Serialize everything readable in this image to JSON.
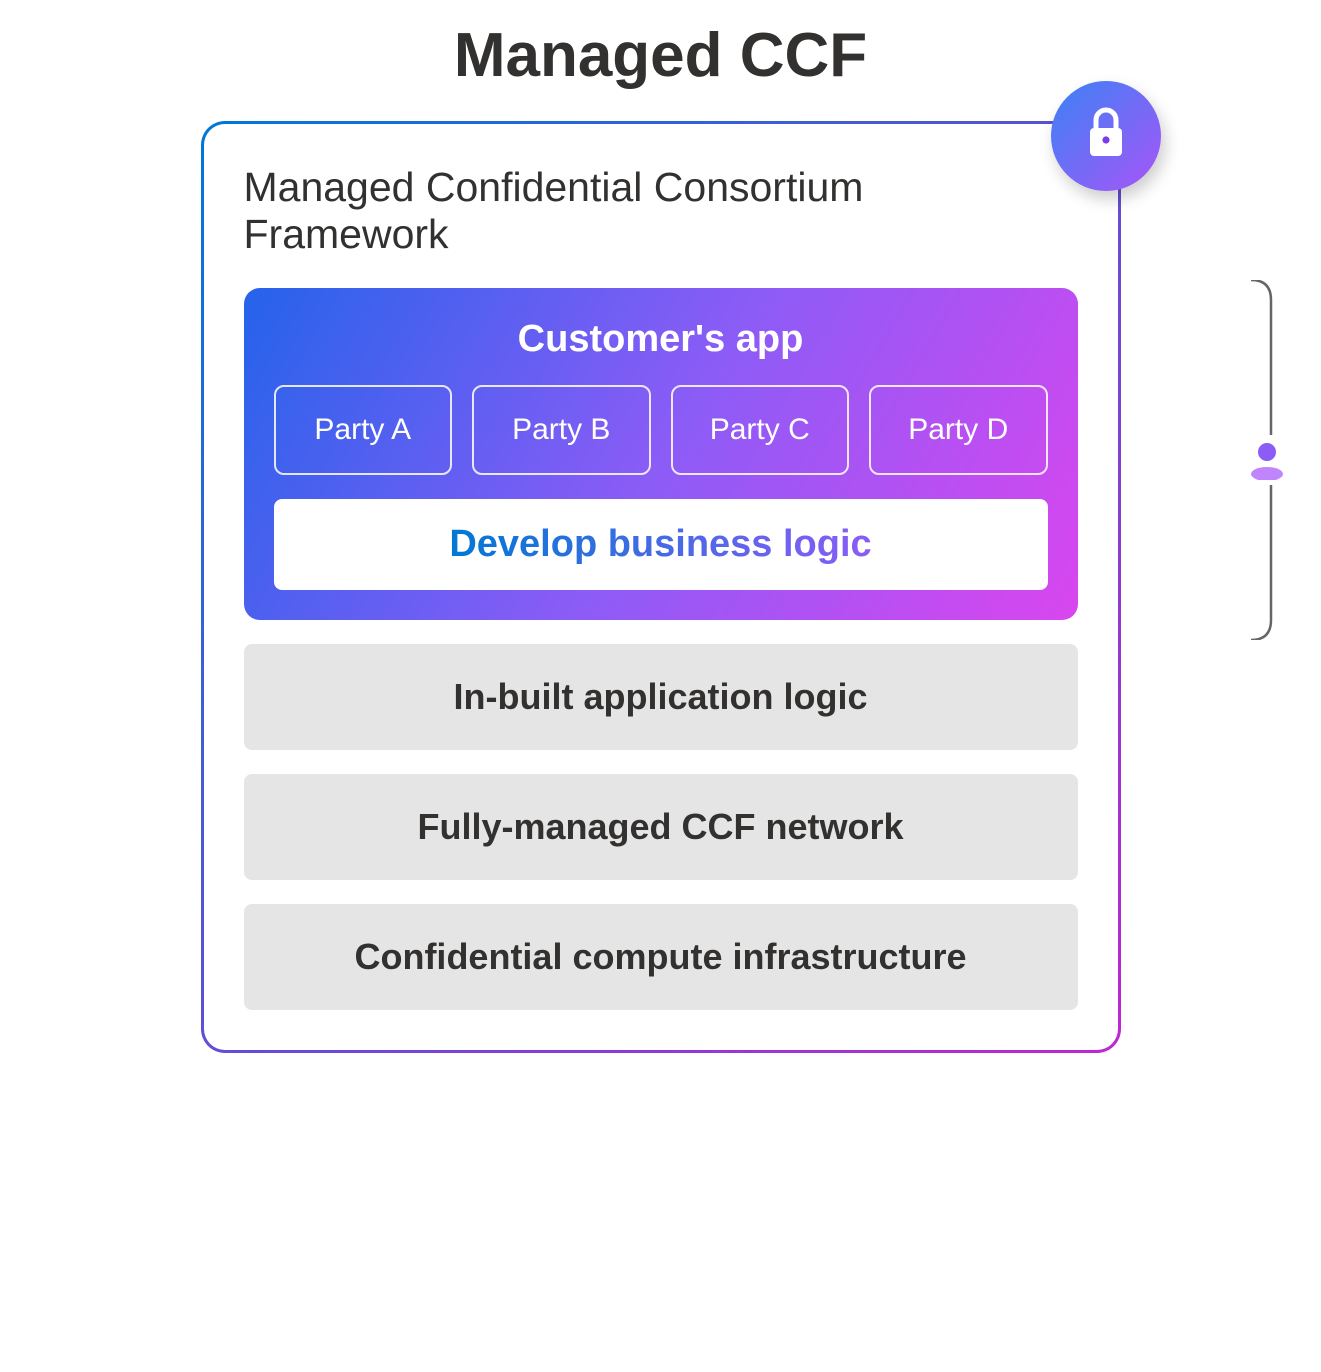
{
  "title": "Managed CCF",
  "subtitle": "Managed Confidential Consortium Framework",
  "customer_app": {
    "title": "Customer's app",
    "parties": [
      "Party A",
      "Party B",
      "Party C",
      "Party D"
    ],
    "develop_label": "Develop business logic"
  },
  "layers": [
    "In-built application logic",
    "Fully-managed CCF network",
    "Confidential compute infrastructure"
  ],
  "icons": {
    "lock": "lock-icon",
    "user": "user-icon"
  }
}
